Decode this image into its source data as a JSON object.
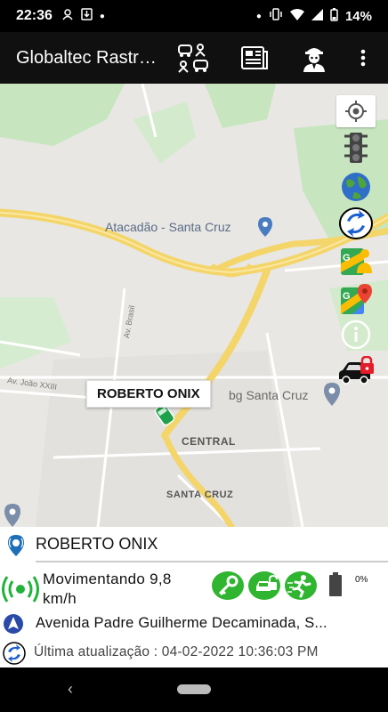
{
  "status_bar": {
    "time": "22:36",
    "battery_pct": "14%"
  },
  "app_bar": {
    "title": "Globaltec Rastreamento"
  },
  "map": {
    "labels": {
      "atacadao": "Atacadão - Santa Cruz",
      "av_brasil": "Av. Brasil",
      "av_joao": "Av. João XXIII",
      "bg": "bg Santa Cruz",
      "central": "CENTRAL",
      "santa_cruz": "SANTA CRUZ"
    },
    "vehicle_tag": "ROBERTO ONIX"
  },
  "panel": {
    "vehicle_name": "ROBERTO ONIX",
    "movement": "Movimentando 9,8 km/h",
    "battery_pct": "0%",
    "address": "Avenida Padre Guilherme Decaminada, S...",
    "last_update": "Última atualização : 04-02-2022 10:36:03 PM"
  }
}
